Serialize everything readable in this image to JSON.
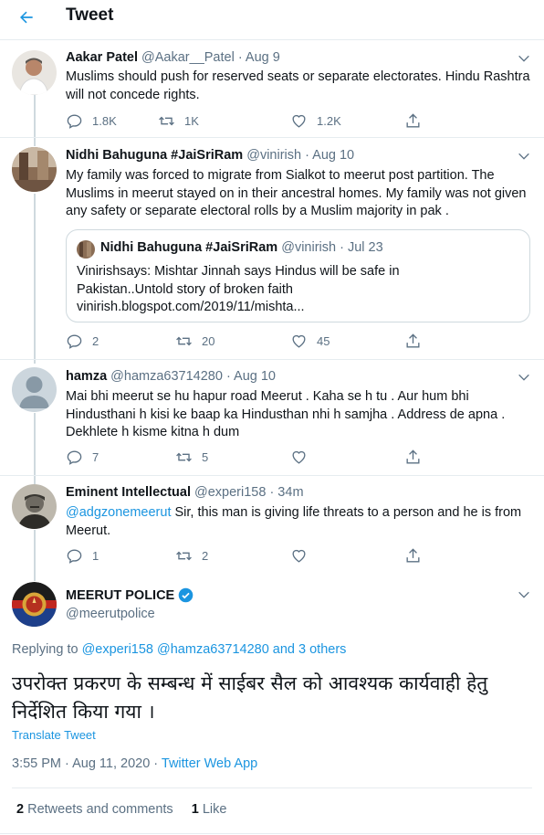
{
  "header": {
    "title": "Tweet"
  },
  "colors": {
    "accent": "#1b95e0",
    "muted": "#5b7083",
    "text": "#0f1419",
    "border": "#e6ecf0"
  },
  "tweets": [
    {
      "name": "Aakar Patel",
      "handle": "@Aakar__Patel",
      "date": "· Aug 9",
      "text": "Muslims should push for reserved seats or separate electorates. Hindu Rashtra will not concede rights.",
      "replies": "1.8K",
      "retweets": "1K",
      "likes": "1.2K"
    },
    {
      "name": "Nidhi Bahuguna #JaiSriRam",
      "handle": "@vinirish",
      "date": "· Aug 10",
      "text": "My family was forced to migrate from Sialkot to meerut post partition. The Muslims in meerut stayed on in their ancestral homes. My family was not given any safety or separate electoral rolls by a Muslim majority in pak .",
      "replies": "2",
      "retweets": "20",
      "likes": "45",
      "quote": {
        "name": "Nidhi Bahuguna #JaiSriRam",
        "handle": "@vinirish",
        "date": "· Jul 23",
        "text_line1": "Vinirishsays: Mishtar Jinnah says Hindus will be safe in",
        "text_line2": "Pakistan..Untold story of broken faith",
        "text_line3": "vinirish.blogspot.com/2019/11/mishta..."
      }
    },
    {
      "name": "hamza",
      "handle": "@hamza63714280",
      "date": "· Aug 10",
      "text": "Mai bhi meerut se hu hapur road Meerut . Kaha se h tu . Aur hum bhi Hindusthani h kisi ke baap ka Hindusthan nhi h samjha . Address de apna . Dekhlete h kisme kitna h dum",
      "replies": "7",
      "retweets": "5",
      "likes": ""
    },
    {
      "name": "Eminent Intellectual",
      "handle": "@experi158",
      "date": "· 34m",
      "mention": "@adgzonemeerut",
      "text": " Sir, this man is giving life threats to a person and he is from Meerut.",
      "replies": "1",
      "retweets": "2",
      "likes": ""
    }
  ],
  "main_tweet": {
    "name": "MEERUT POLICE",
    "handle": "@meerutpolice",
    "replying_prefix": "Replying to ",
    "replying_to": "@experi158 @hamza63714280 and 3 others",
    "text": "उपरोक्त प्रकरण के सम्बन्ध में साईबर सैल को आवश्यक कार्यवाही हेतु निर्देशित किया गया ।",
    "translate": "Translate Tweet",
    "time": "3:55 PM · Aug 11, 2020 · ",
    "source": "Twitter Web App",
    "retweets_count": "2",
    "retweets_label": " Retweets and comments",
    "likes_count": "1",
    "likes_label": " Like"
  }
}
